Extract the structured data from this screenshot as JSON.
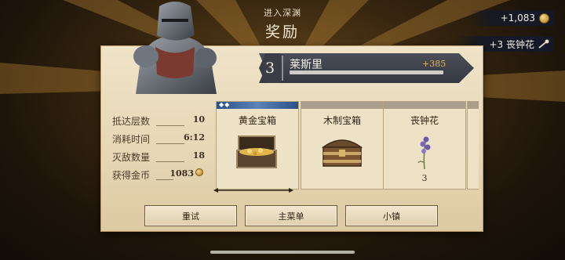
{
  "header": {
    "subtitle": "进入深渊",
    "title": "奖励"
  },
  "resources": {
    "gold": "+1,083",
    "item": "+3 丧钟花"
  },
  "hero": {
    "level": "3",
    "name": "莱斯里",
    "xp_gain": "+385"
  },
  "stats": [
    {
      "label": "抵达层数",
      "value": "10"
    },
    {
      "label": "消耗时间",
      "value": "6:12"
    },
    {
      "label": "灭敌数量",
      "value": "18"
    },
    {
      "label": "获得金币",
      "value": "1083"
    }
  ],
  "rewards": [
    {
      "name": "黄金宝箱",
      "qty": "",
      "selected": true,
      "icon": "golden-chest-icon"
    },
    {
      "name": "木制宝箱",
      "qty": "",
      "selected": false,
      "icon": "wooden-chest-icon"
    },
    {
      "name": "丧钟花",
      "qty": "3",
      "selected": false,
      "icon": "bellflower-icon"
    }
  ],
  "buttons": {
    "retry": "重试",
    "main_menu": "主菜单",
    "town": "小镇"
  },
  "colors": {
    "accent": "#e6b35a",
    "selected_header": "#2c4f8a",
    "paper": "#e6d6b4"
  }
}
